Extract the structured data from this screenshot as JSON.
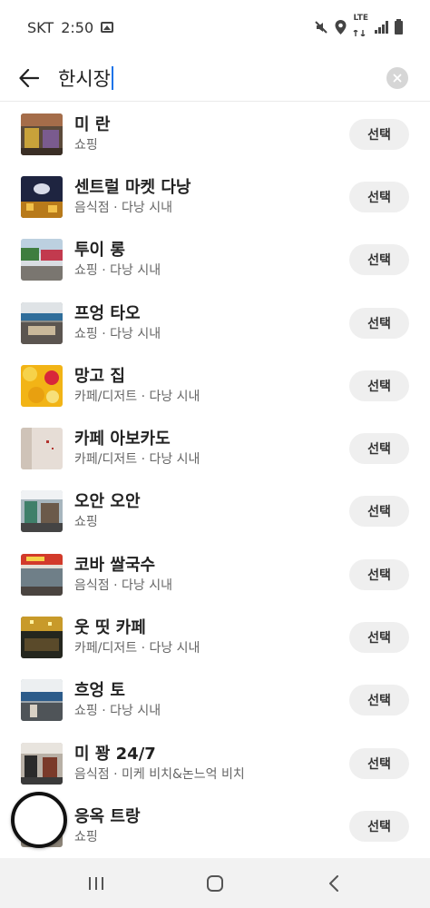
{
  "status_bar": {
    "carrier": "SKT",
    "time": "2:50",
    "network": "LTE",
    "icons": [
      "gallery-icon",
      "mute-icon",
      "location-icon",
      "lte-icon",
      "signal-icon",
      "battery-icon"
    ]
  },
  "search": {
    "query": "한시장",
    "back_icon": "arrow-left-icon",
    "clear_icon": "clear-icon"
  },
  "results": [
    {
      "name": "미 란",
      "meta": "쇼핑",
      "button": "선택"
    },
    {
      "name": "센트럴 마켓 다낭",
      "meta": "음식점 · 다낭 시내",
      "button": "선택"
    },
    {
      "name": "투이 롱",
      "meta": "쇼핑 · 다낭 시내",
      "button": "선택"
    },
    {
      "name": "프엉 타오",
      "meta": "쇼핑 · 다낭 시내",
      "button": "선택"
    },
    {
      "name": "망고 집",
      "meta": "카페/디저트 · 다낭 시내",
      "button": "선택"
    },
    {
      "name": "카페 아보카도",
      "meta": "카페/디저트 · 다낭 시내",
      "button": "선택"
    },
    {
      "name": "오안 오안",
      "meta": "쇼핑",
      "button": "선택"
    },
    {
      "name": "코바 쌀국수",
      "meta": "음식점 · 다낭 시내",
      "button": "선택"
    },
    {
      "name": "웃 띳 카페",
      "meta": "카페/디저트 · 다낭 시내",
      "button": "선택"
    },
    {
      "name": "흐엉 토",
      "meta": "쇼핑 · 다낭 시내",
      "button": "선택"
    },
    {
      "name": "미 꽝 24/7",
      "meta": "음식점 · 미케 비치&논느억 비치",
      "button": "선택"
    },
    {
      "name": "응옥 트랑",
      "meta": "쇼핑",
      "button": "선택"
    }
  ],
  "nav_bar": {
    "icons": [
      "recent-apps-icon",
      "home-icon",
      "back-icon"
    ]
  },
  "colors": {
    "accent_caret": "#1a73e8",
    "button_bg": "#efefef",
    "nav_bg": "#f2f2f2"
  }
}
